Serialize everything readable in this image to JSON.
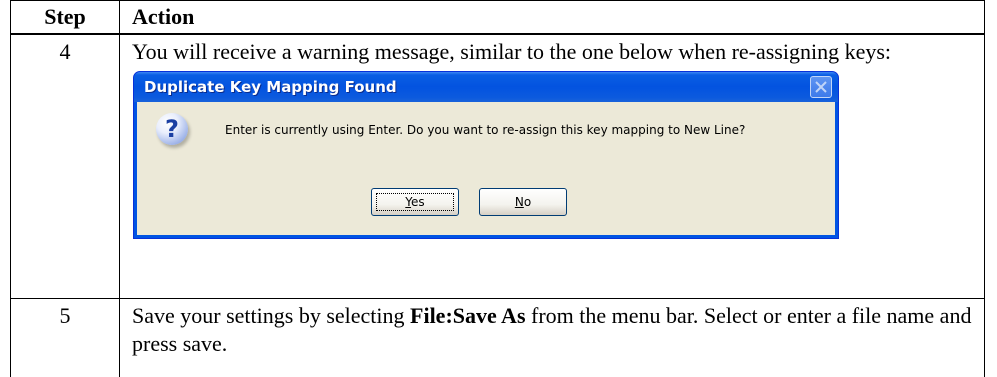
{
  "table": {
    "header": {
      "step": "Step",
      "action": "Action"
    },
    "rows": [
      {
        "step": "4",
        "text": "You will receive a warning message, similar to the one below when re-assigning keys:"
      },
      {
        "step": "5",
        "text_before": "Save your settings by selecting ",
        "text_bold": "File:Save As",
        "text_after": " from the menu bar. Select or enter a file name and press save."
      }
    ]
  },
  "dialog": {
    "title": "Duplicate Key Mapping Found",
    "message": "Enter is currently using Enter.  Do you want to re-assign this key mapping to New Line?",
    "icon": "question-icon",
    "close_icon": "close-icon",
    "buttons": {
      "yes_underline": "Y",
      "yes_rest": "es",
      "no_underline": "N",
      "no_rest": "o"
    },
    "colors": {
      "titlebar": "#0054e3",
      "body": "#ece9d8",
      "button_border": "#003c74"
    }
  }
}
